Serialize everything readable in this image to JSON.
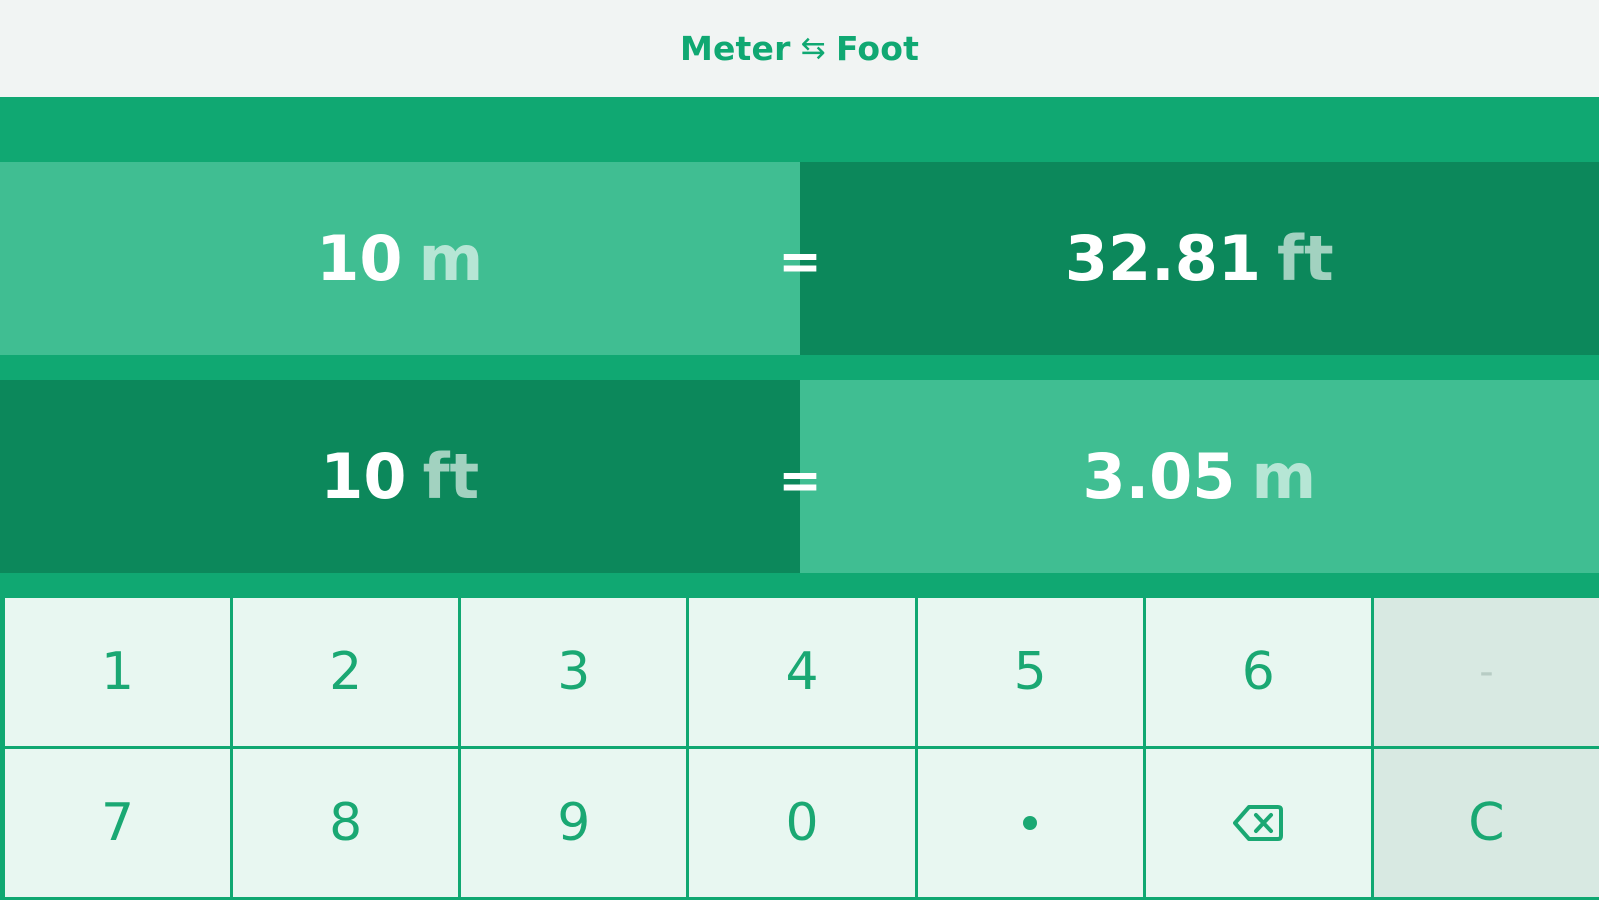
{
  "header": {
    "from_unit": "Meter",
    "swap_symbol": "⇆",
    "to_unit": "Foot"
  },
  "conversions": [
    {
      "input_value": "10",
      "input_unit": "m",
      "equals": "=",
      "result_value": "32.81",
      "result_unit": "ft"
    },
    {
      "input_value": "10",
      "input_unit": "ft",
      "equals": "=",
      "result_value": "3.05",
      "result_unit": "m"
    }
  ],
  "keypad": {
    "row1": [
      "1",
      "2",
      "3",
      "4",
      "5",
      "6",
      "-"
    ],
    "row2": [
      "7",
      "8",
      "9",
      "0",
      "",
      "",
      "C"
    ],
    "icons": {
      "decimal": "decimal-point-icon",
      "backspace": "backspace-icon"
    }
  },
  "colors": {
    "brand_green": "#10a872",
    "light_cell": "#40be92",
    "dark_cell": "#0c885b",
    "key_bg": "#e8f7f1",
    "fn_key_bg": "#d8e9e2",
    "title_bg": "#f1f4f3"
  }
}
